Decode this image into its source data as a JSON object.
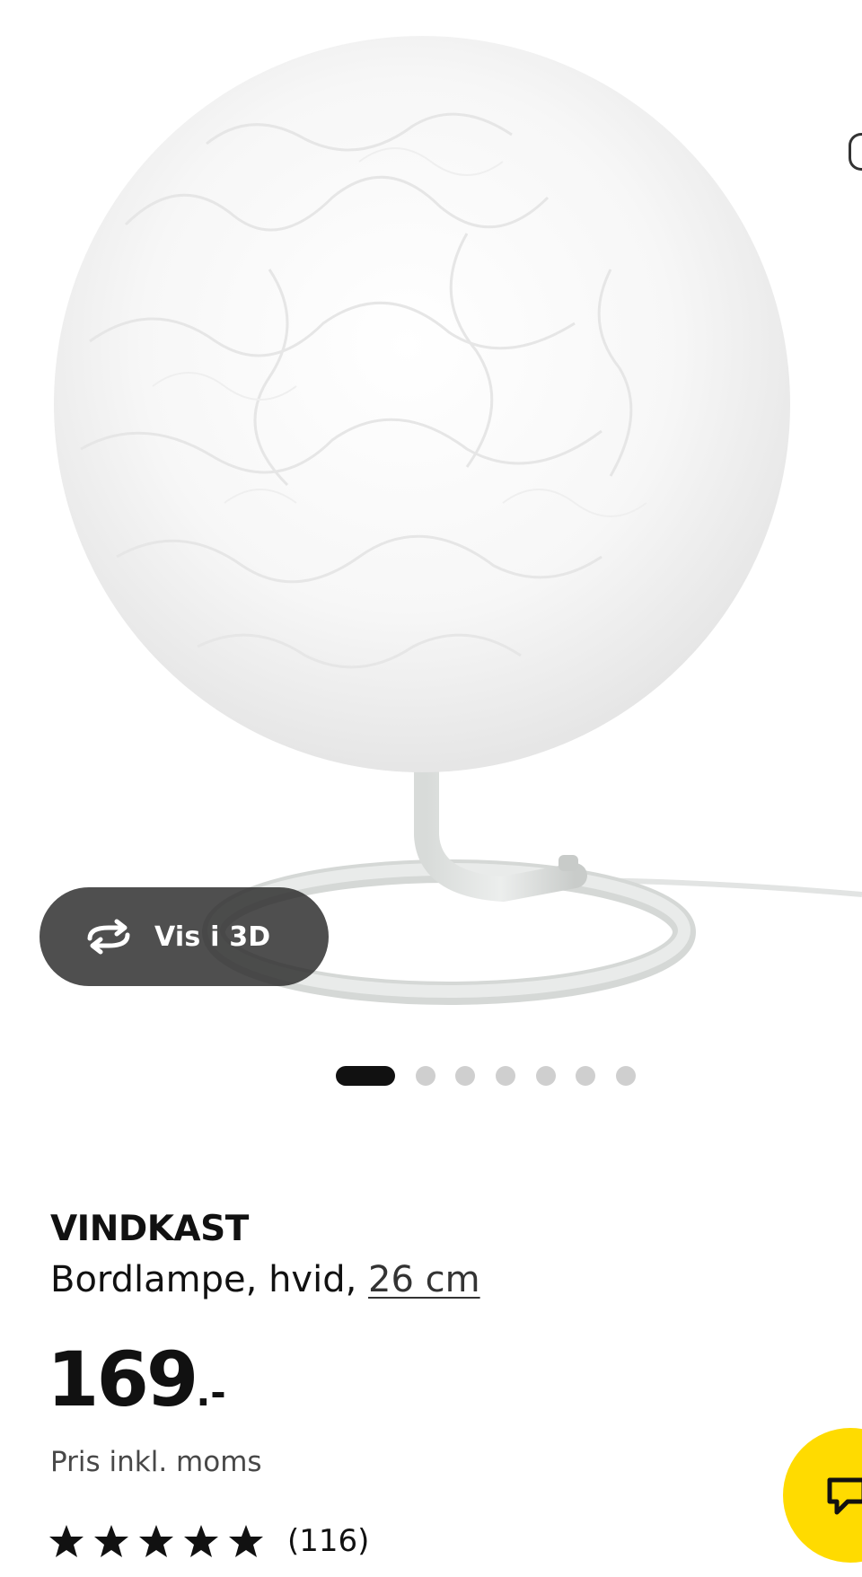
{
  "hero": {
    "view_3d_label": "Vis i 3D",
    "image_count": 7,
    "active_index": 0
  },
  "product": {
    "name": "VINDKAST",
    "description_prefix": "Bordlampe, hvid,",
    "size_link": "26 cm",
    "price_value": "169",
    "price_suffix": ".-",
    "vat_note": "Pris inkl. moms",
    "rating": {
      "stars": 5,
      "count_label": "(116)"
    }
  },
  "colors": {
    "chat_button": "#ffdb00",
    "active_dot": "#111111",
    "inactive_dot": "#cfcfcf"
  },
  "icons": {
    "view_3d": "rotate-3d-icon",
    "chat": "chat-bubble-icon",
    "star": "star-icon"
  }
}
